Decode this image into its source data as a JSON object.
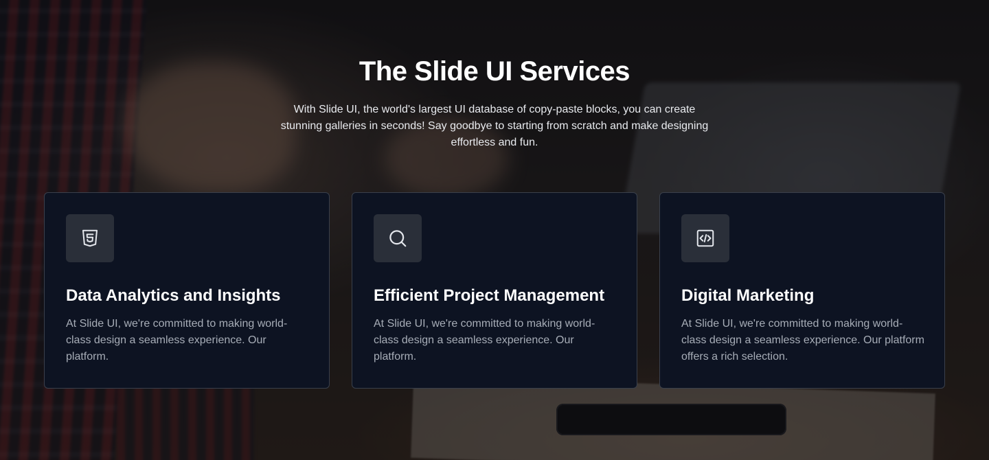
{
  "hero": {
    "title": "The Slide UI Services",
    "description": "With Slide UI, the world's largest UI database of copy-paste blocks, you can create stunning galleries in seconds! Say goodbye to starting from scratch and make designing effortless and fun."
  },
  "services": [
    {
      "icon": "html5-icon",
      "title": "Data Analytics and Insights",
      "description": "At Slide UI, we're committed to making world-class design a seamless experience. Our platform."
    },
    {
      "icon": "search-icon",
      "title": "Efficient Project Management",
      "description": "At Slide UI, we're committed to making world-class design a seamless experience. Our platform."
    },
    {
      "icon": "code-icon",
      "title": "Digital Marketing",
      "description": "At Slide UI, we're committed to making world-class design a seamless experience. Our platform offers a rich selection."
    }
  ],
  "colors": {
    "card_background": "#0d1322",
    "card_border": "#3a404c",
    "icon_background": "#2a2f39",
    "body_text": "#a7adb7"
  }
}
